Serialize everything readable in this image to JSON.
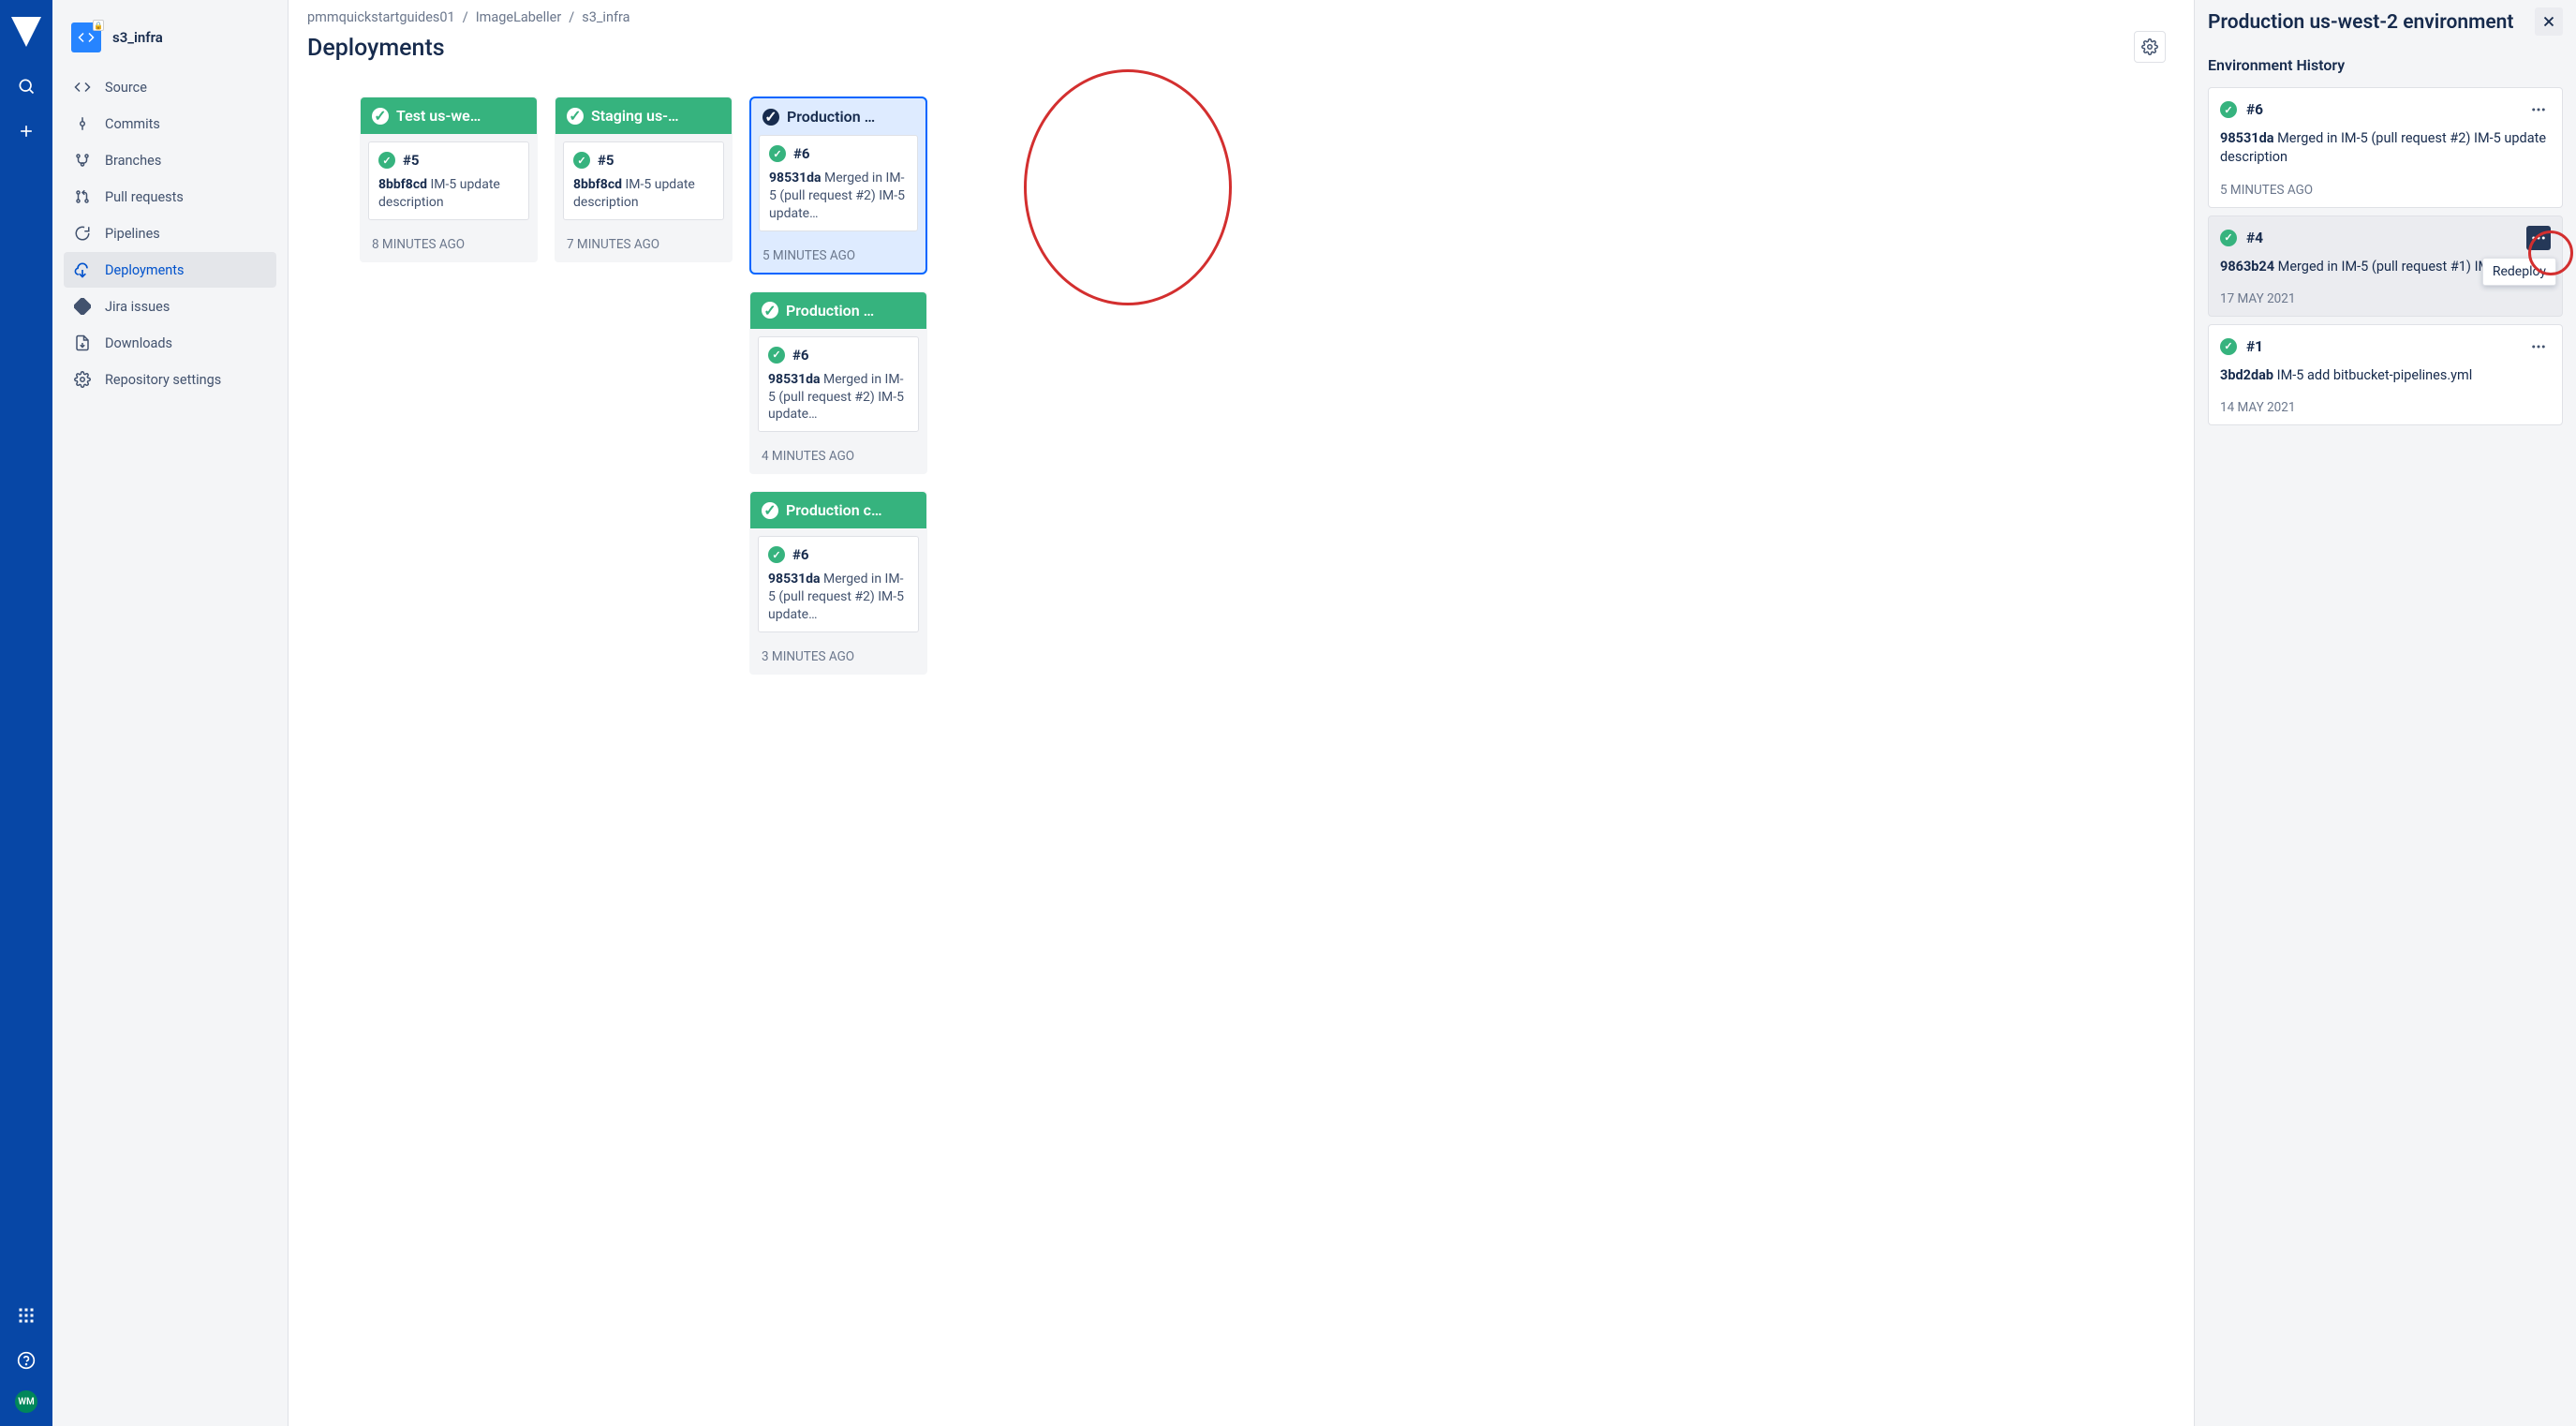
{
  "rail": {
    "avatar_initials": "WM"
  },
  "repo": {
    "name": "s3_infra"
  },
  "nav": {
    "source": "Source",
    "commits": "Commits",
    "branches": "Branches",
    "pull_requests": "Pull requests",
    "pipelines": "Pipelines",
    "deployments": "Deployments",
    "jira_issues": "Jira issues",
    "downloads": "Downloads",
    "repo_settings": "Repository settings"
  },
  "breadcrumb": {
    "a": "pmmquickstartguides01",
    "b": "ImageLabeller",
    "c": "s3_infra"
  },
  "page": {
    "title": "Deployments"
  },
  "envs": [
    {
      "name": "Test us-we…",
      "build": "#5",
      "hash": "8bbf8cd",
      "msg": "IM-5 update description",
      "time": "8 MINUTES AGO",
      "selected": false
    },
    {
      "name": "Staging us-…",
      "build": "#5",
      "hash": "8bbf8cd",
      "msg": "IM-5 update description",
      "time": "7 MINUTES AGO",
      "selected": false
    },
    {
      "name": "Production …",
      "build": "#6",
      "hash": "98531da",
      "msg": "Merged in IM-5 (pull request #2) IM-5 update…",
      "time": "5 MINUTES AGO",
      "selected": true
    },
    {
      "name": "Production …",
      "build": "#6",
      "hash": "98531da",
      "msg": "Merged in IM-5 (pull request #2) IM-5 update…",
      "time": "4 MINUTES AGO",
      "selected": false
    },
    {
      "name": "Production c…",
      "build": "#6",
      "hash": "98531da",
      "msg": "Merged in IM-5 (pull request #2) IM-5 update…",
      "time": "3 MINUTES AGO",
      "selected": false
    }
  ],
  "panel": {
    "title": "Production us-west-2 environment",
    "subtitle": "Environment History",
    "tooltip": "Redeploy",
    "items": [
      {
        "build": "#6",
        "hash": "98531da",
        "msg": "Merged in IM-5 (pull request #2) IM-5 update description",
        "time": "5 MINUTES AGO",
        "hover": false,
        "dark": false
      },
      {
        "build": "#4",
        "hash": "9863b24",
        "msg": "Merged in IM-5 (pull request #1) IM-5 tweak",
        "time": "17 MAY 2021",
        "hover": true,
        "dark": true
      },
      {
        "build": "#1",
        "hash": "3bd2dab",
        "msg": "IM-5 add bitbucket-pipelines.yml",
        "time": "14 MAY 2021",
        "hover": false,
        "dark": false
      }
    ]
  }
}
